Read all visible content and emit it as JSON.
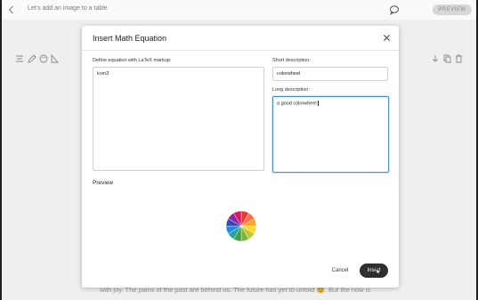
{
  "app": {
    "doc_title": "Let's add an image to a table",
    "preview_label": "PREVIEW",
    "body_text": "with joy. The pains of the past are behind us. The future has yet to unfold 😊. But the now is"
  },
  "dialog": {
    "title": "Insert Math Equation",
    "latex_label": "Define equation with LaTeX markup:",
    "latex_value": "icon3",
    "short_label": "Short description:",
    "short_value": "colorwheel",
    "long_label": "Long description:",
    "long_value": "a good colorwheel",
    "preview_label": "Preview",
    "cancel_label": "Cancel",
    "insert_label": "Insert"
  },
  "colors": {
    "accent": "#4a90d9",
    "insert_button": "#2f2f2f",
    "wheel": [
      "#e53935",
      "#ff7043",
      "#ffa726",
      "#fdd835",
      "#c0ca33",
      "#7cb342",
      "#43a047",
      "#26a69a",
      "#1e88e5",
      "#3949ab",
      "#8e24aa",
      "#d81b60"
    ]
  },
  "icons": {
    "back": "chevron-left-icon",
    "comment": "comment-icon",
    "close": "close-icon",
    "toolbar_left": [
      "align-icon",
      "pencil-icon",
      "palette-icon",
      "ruler-icon"
    ],
    "toolbar_right": [
      "download-icon",
      "copy-icon",
      "trash-icon"
    ]
  }
}
